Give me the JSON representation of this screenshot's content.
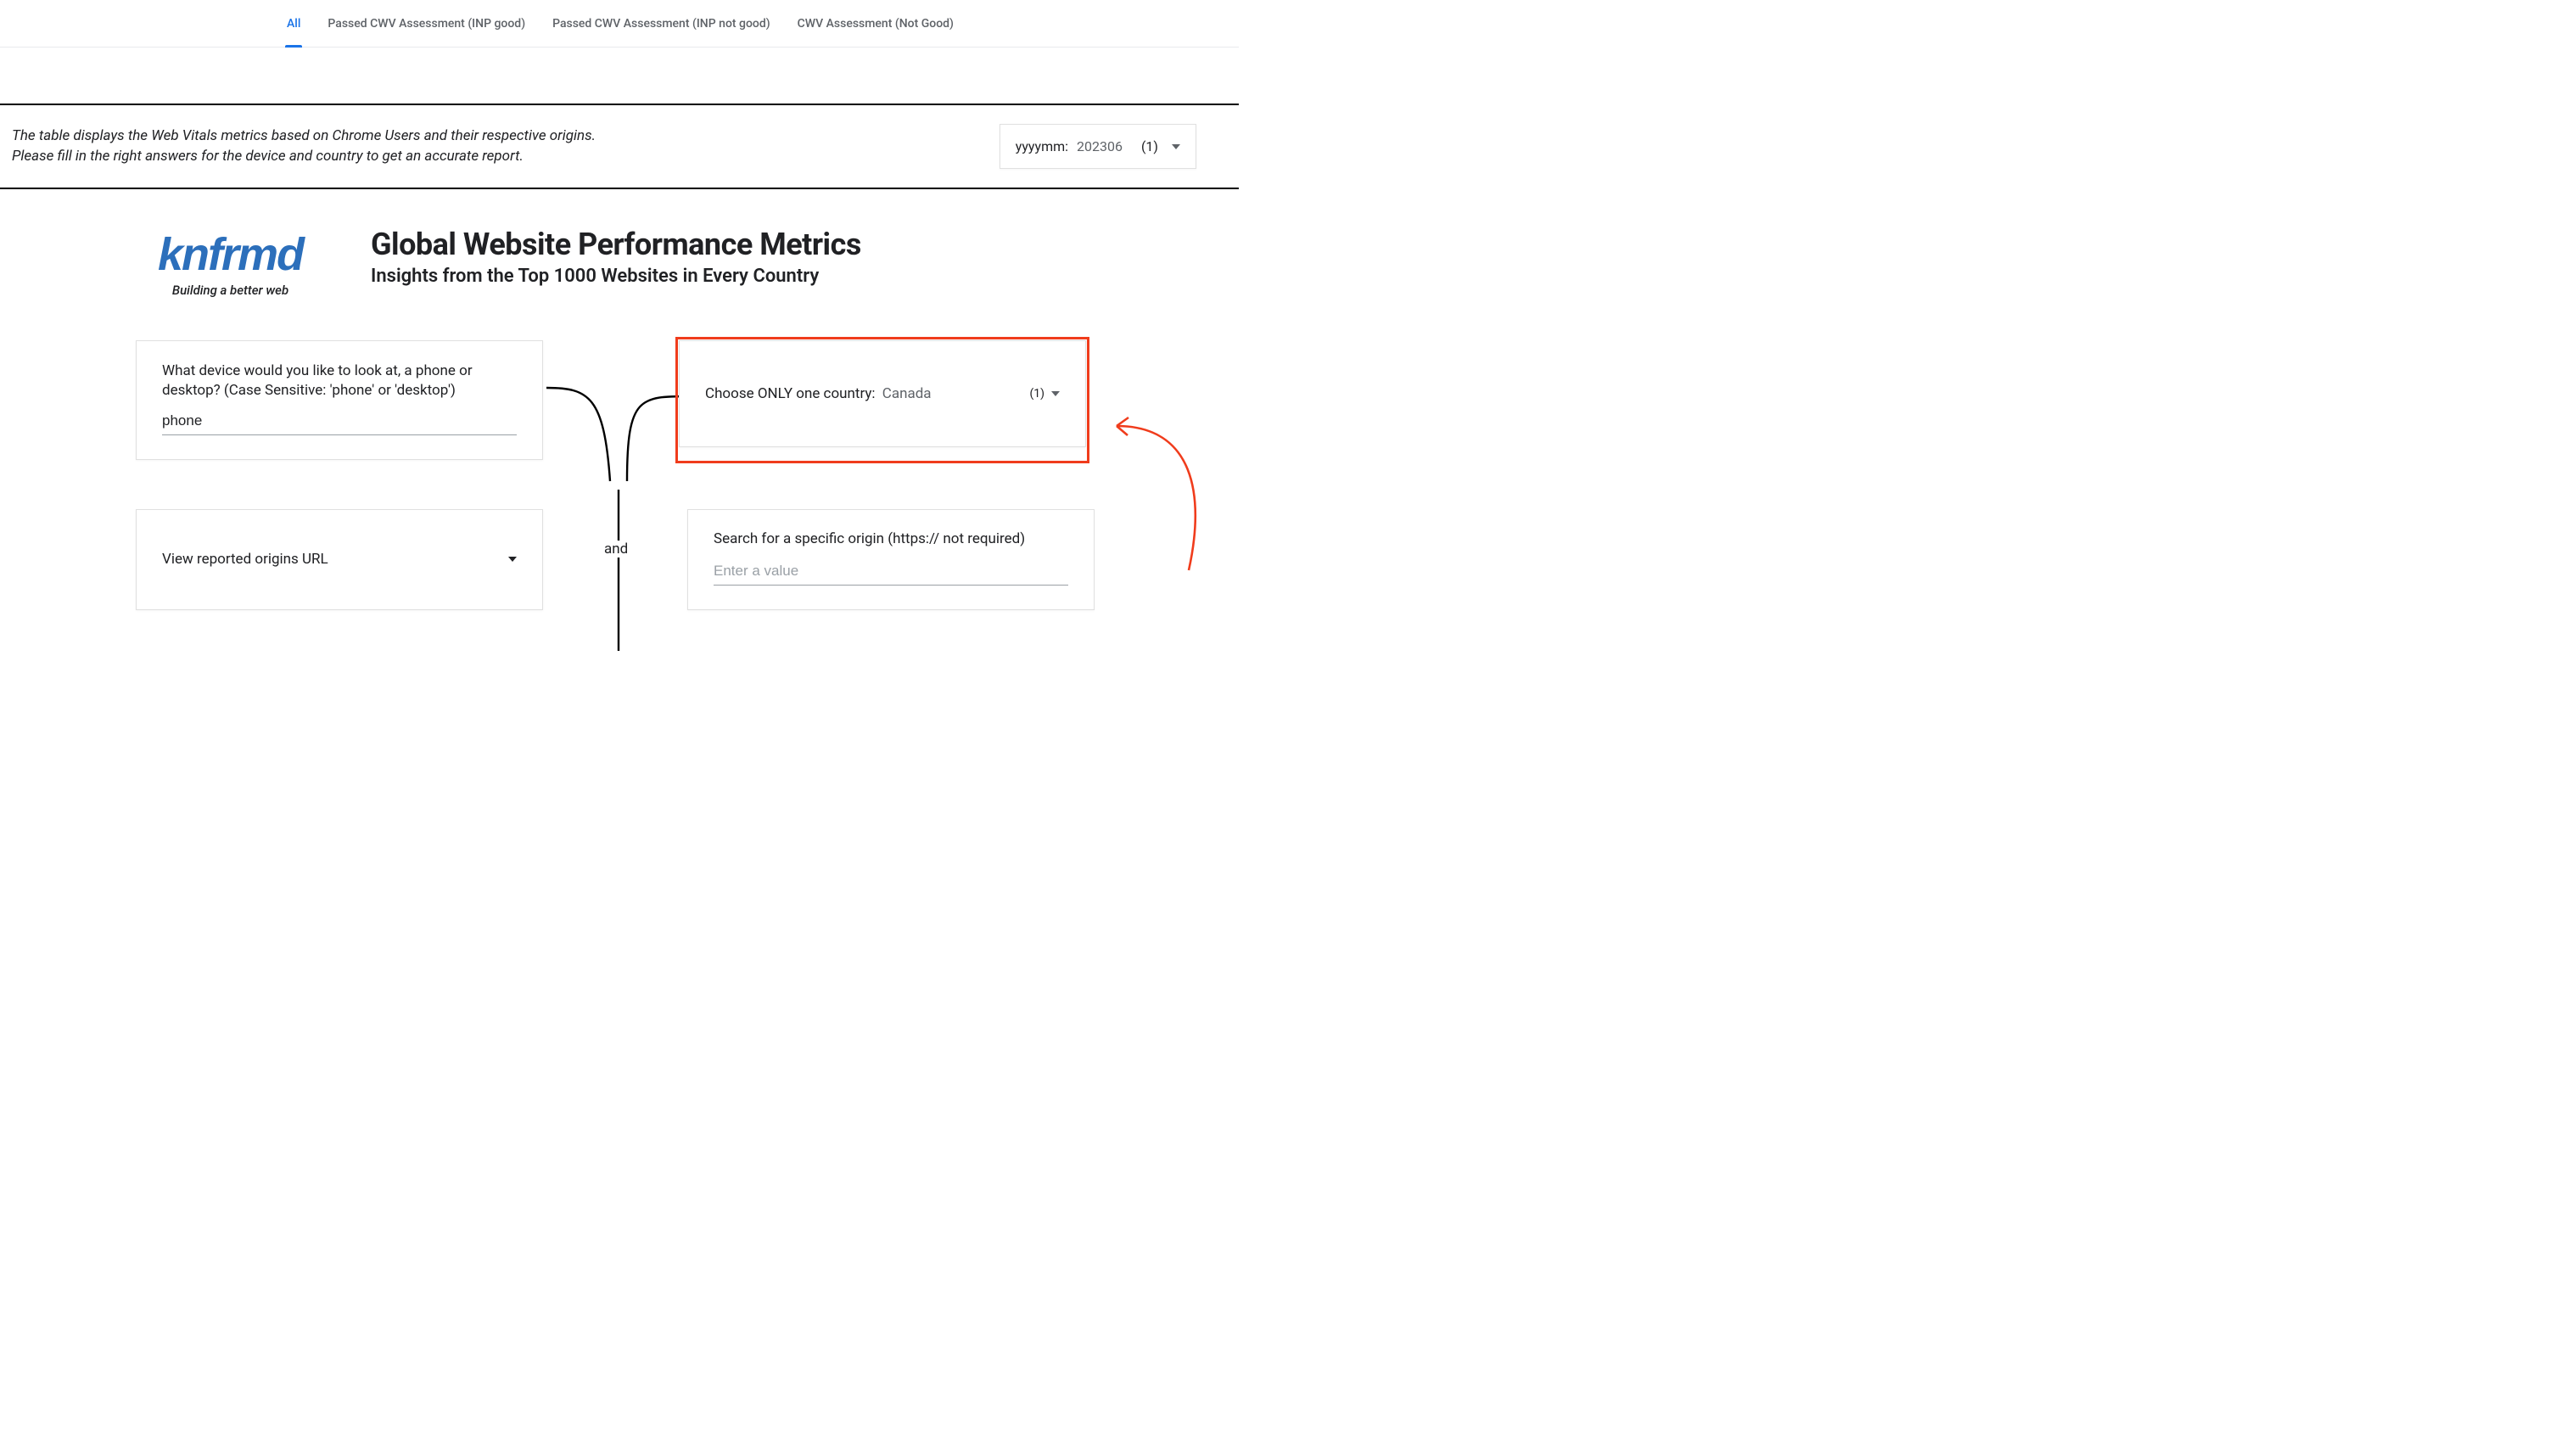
{
  "tabs": {
    "all": "All",
    "passed_good": "Passed CWV Assessment (INP good)",
    "passed_not_good": "Passed CWV Assessment (INP not good)",
    "not_good": "CWV Assessment (Not Good)"
  },
  "header": {
    "line1": "The table displays the Web Vitals metrics based on Chrome Users and their respective origins.",
    "line2": "Please fill in the right answers for the device and country to get an accurate report."
  },
  "date": {
    "label": "yyyymm:",
    "value": "202306",
    "count": "(1)"
  },
  "logo": {
    "text": "knfrmd",
    "tagline": "Building a better web"
  },
  "titles": {
    "main": "Global Website Performance Metrics",
    "sub": "Insights from the Top 1000 Websites in Every Country"
  },
  "device": {
    "question": "What device would you like to look at, a phone or desktop? (Case Sensitive: 'phone' or 'desktop')",
    "value": "phone"
  },
  "country": {
    "label": "Choose ONLY one country:",
    "value": "Canada",
    "count": "(1)"
  },
  "url_select": {
    "label": "View reported origins URL"
  },
  "connector_label": "and",
  "origin": {
    "question": "Search for a specific origin (https:// not required)",
    "placeholder": "Enter a value"
  }
}
